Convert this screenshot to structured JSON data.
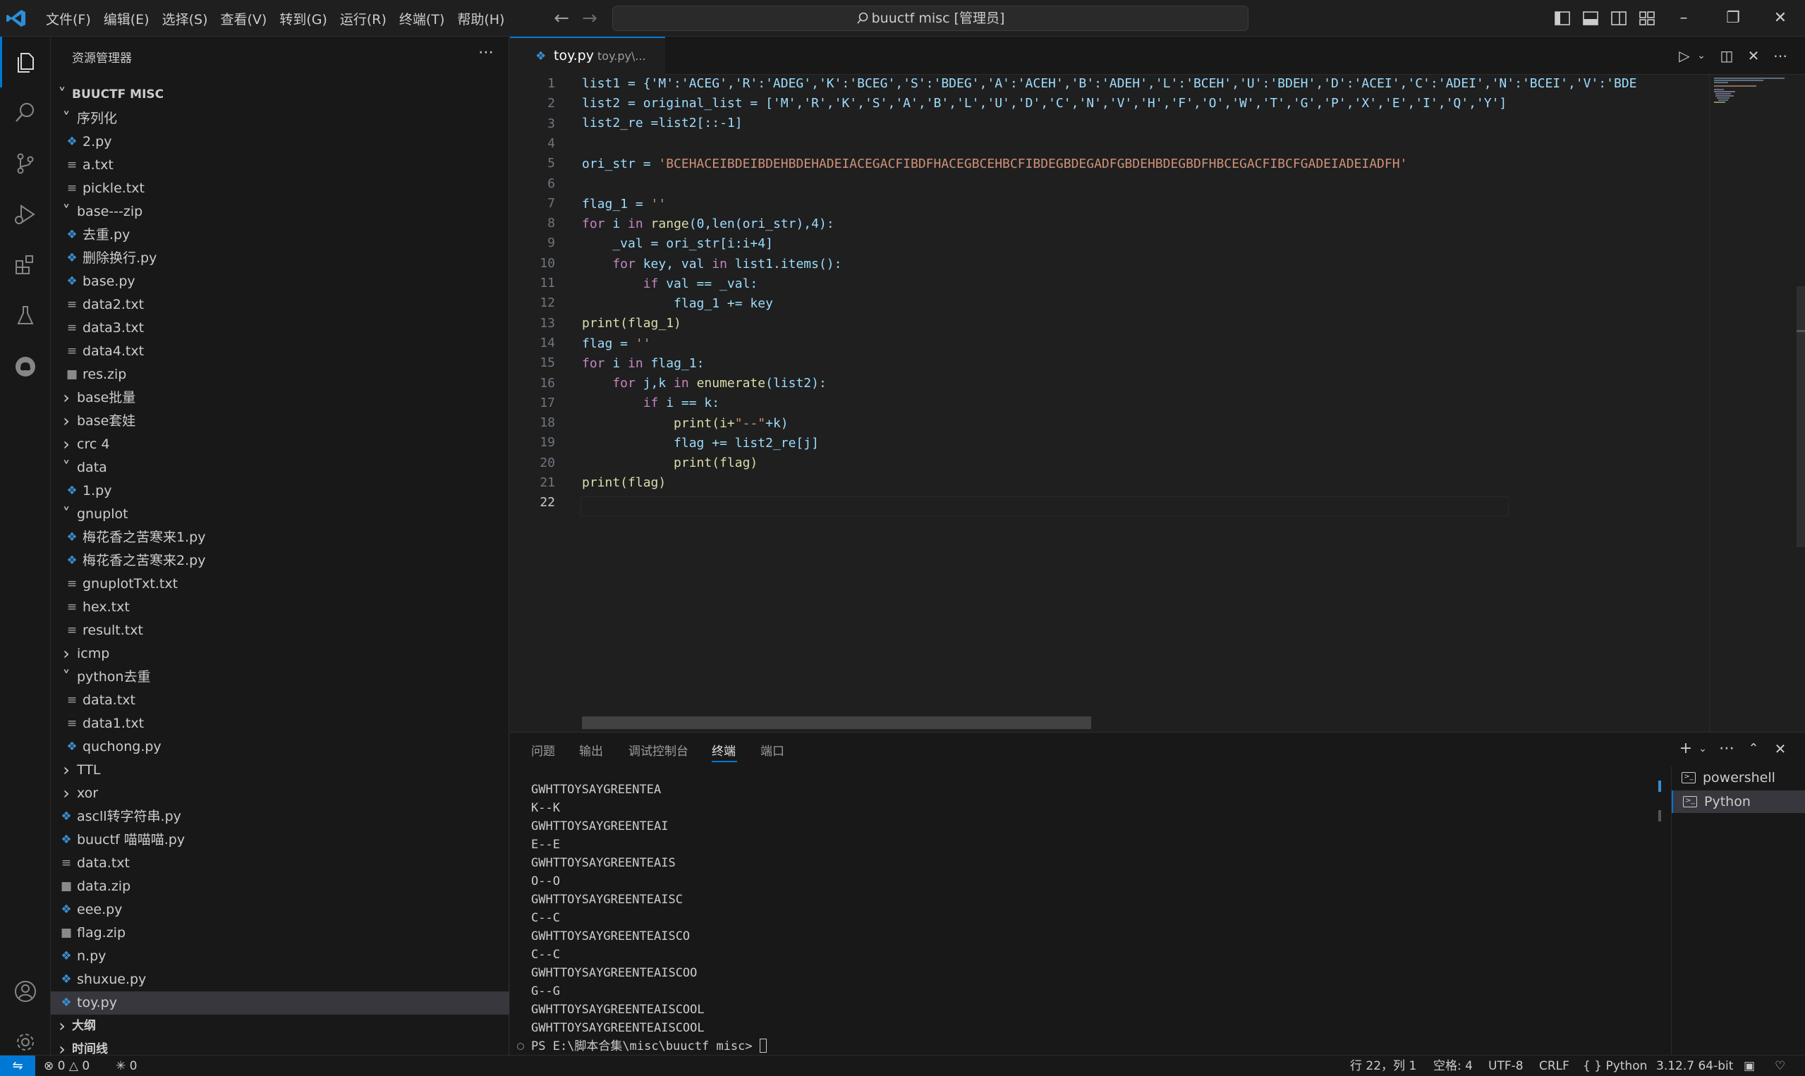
{
  "titlebar": {
    "menu": [
      "文件(F)",
      "编辑(E)",
      "选择(S)",
      "查看(V)",
      "转到(G)",
      "运行(R)",
      "终端(T)",
      "帮助(H)"
    ],
    "search_text": "buuctf misc [管理员]"
  },
  "sidebar": {
    "title": "资源管理器",
    "root": "BUUCTF MISC",
    "items": [
      {
        "label": "序列化",
        "kind": "folder-open"
      },
      {
        "label": "2.py",
        "kind": "py"
      },
      {
        "label": "a.txt",
        "kind": "txt"
      },
      {
        "label": "pickle.txt",
        "kind": "txt"
      },
      {
        "label": "base---zip",
        "kind": "folder-open"
      },
      {
        "label": "去重.py",
        "kind": "py"
      },
      {
        "label": "删除换行.py",
        "kind": "py"
      },
      {
        "label": "base.py",
        "kind": "py"
      },
      {
        "label": "data2.txt",
        "kind": "txt"
      },
      {
        "label": "data3.txt",
        "kind": "txt"
      },
      {
        "label": "data4.txt",
        "kind": "txt"
      },
      {
        "label": "res.zip",
        "kind": "zip"
      },
      {
        "label": "base批量",
        "kind": "folder-closed"
      },
      {
        "label": "base套娃",
        "kind": "folder-closed"
      },
      {
        "label": "crc 4",
        "kind": "folder-closed"
      },
      {
        "label": "data",
        "kind": "folder-open"
      },
      {
        "label": "1.py",
        "kind": "py"
      },
      {
        "label": "gnuplot",
        "kind": "folder-open"
      },
      {
        "label": "梅花香之苦寒来1.py",
        "kind": "py"
      },
      {
        "label": "梅花香之苦寒来2.py",
        "kind": "py"
      },
      {
        "label": "gnuplotTxt.txt",
        "kind": "txt"
      },
      {
        "label": "hex.txt",
        "kind": "txt"
      },
      {
        "label": "result.txt",
        "kind": "txt"
      },
      {
        "label": "icmp",
        "kind": "folder-closed"
      },
      {
        "label": "python去重",
        "kind": "folder-open"
      },
      {
        "label": "data.txt",
        "kind": "txt"
      },
      {
        "label": "data1.txt",
        "kind": "txt"
      },
      {
        "label": "quchong.py",
        "kind": "py"
      },
      {
        "label": "TTL",
        "kind": "folder-closed"
      },
      {
        "label": "xor",
        "kind": "folder-closed"
      },
      {
        "label": "ascll转字符串.py",
        "kind": "py"
      },
      {
        "label": "buuctf 喵喵喵.py",
        "kind": "py"
      },
      {
        "label": "data.txt",
        "kind": "txt"
      },
      {
        "label": "data.zip",
        "kind": "zip"
      },
      {
        "label": "eee.py",
        "kind": "py"
      },
      {
        "label": "flag.zip",
        "kind": "zip"
      },
      {
        "label": "n.py",
        "kind": "py"
      },
      {
        "label": "shuxue.py",
        "kind": "py"
      },
      {
        "label": "toy.py",
        "kind": "py"
      }
    ],
    "outline": "大纲",
    "timeline": "时间线"
  },
  "editor": {
    "tab_name": "toy.py",
    "tab_path": "toy.py\\...",
    "line_numbers": [
      "1",
      "2",
      "3",
      "4",
      "5",
      "6",
      "7",
      "8",
      "9",
      "10",
      "11",
      "12",
      "13",
      "14",
      "15",
      "16",
      "17",
      "18",
      "19",
      "20",
      "21",
      "22"
    ],
    "code": {
      "l1": "list1 = {'M':'ACEG','R':'ADEG','K':'BCEG','S':'BDEG','A':'ACEH','B':'ADEH','L':'BCEH','U':'BDEH','D':'ACEI','C':'ADEI','N':'BCEI','V':'BDE",
      "l2": "list2 = original_list = ['M','R','K','S','A','B','L','U','D','C','N','V','H','F','O','W','T','G','P','X','E','I','Q','Y']",
      "l3": "list2_re =list2[::-1]",
      "l5a": "ori_str = ",
      "l5b": "'BCEHACEIBDEIBDEHBDEHADEIACEGACFIBDFHACEGBCEHBCFIBDEGBDEGADFGBDEHBDEGBDFHBCEGACFIBCFGADEIADEIADFH'",
      "l7a": "flag_1 = ",
      "l7b": "''",
      "l8a": "for",
      "l8b": " i ",
      "l8c": "in",
      "l8d": " range",
      "l8e": "(0,len(ori_str),4):",
      "l9": "    _val = ori_str[i:i+4]",
      "l10a": "    for",
      "l10b": " key, val ",
      "l10c": "in",
      "l10d": " list1.items():",
      "l11a": "        if",
      "l11b": " val == _val:",
      "l12": "            flag_1 += key",
      "l13": "print(flag_1)",
      "l14a": "flag = ",
      "l14b": "''",
      "l15a": "for",
      "l15b": " i ",
      "l15c": "in",
      "l15d": " flag_1:",
      "l16a": "    for",
      "l16b": " j,k ",
      "l16c": "in",
      "l16d": " enumerate",
      "l16e": "(list2):",
      "l17a": "        if",
      "l17b": " i == k:",
      "l18a": "            print(i+",
      "l18b": "\"--\"",
      "l18c": "+k)",
      "l19": "            flag += list2_re[j]",
      "l20": "            print(flag)",
      "l21": "print(flag)"
    }
  },
  "panel": {
    "tabs": [
      "问题",
      "输出",
      "调试控制台",
      "终端",
      "端口"
    ],
    "active_tab": "终端",
    "terminal_lines": [
      "GWHTTOYSAYGREENTEA",
      "K--K",
      "GWHTTOYSAYGREENTEAI",
      "E--E",
      "GWHTTOYSAYGREENTEAIS",
      "O--O",
      "GWHTTOYSAYGREENTEAISC",
      "C--C",
      "GWHTTOYSAYGREENTEAISCO",
      "C--C",
      "GWHTTOYSAYGREENTEAISCOO",
      "G--G",
      "GWHTTOYSAYGREENTEAISCOOL",
      "GWHTTOYSAYGREENTEAISCOOL",
      "PS E:\\脚本合集\\misc\\buuctf misc> "
    ],
    "terminals": [
      "powershell",
      "Python"
    ]
  },
  "statusbar": {
    "errors": "0",
    "warnings": "0",
    "ports": "0",
    "position": "行 22，列 1",
    "spaces": "空格: 4",
    "encoding": "UTF-8",
    "eol": "CRLF",
    "language": "Python",
    "interpreter": "3.12.7 64-bit"
  },
  "colors": {
    "accent": "#0078d4",
    "python_icon": "#3b8ed0"
  }
}
